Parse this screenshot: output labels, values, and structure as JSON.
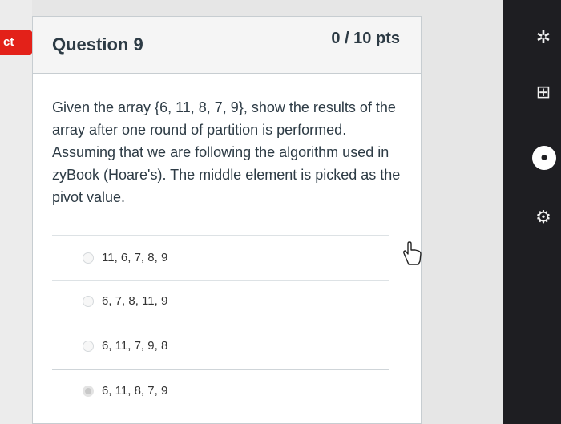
{
  "left_tab": {
    "label": "ct"
  },
  "question": {
    "title": "Question 9",
    "points": "0 / 10 pts",
    "text": "Given the array {6, 11, 8, 7, 9}, show the results of the array after one round of partition is performed. Assuming that we are following the algorithm used in zyBook (Hoare's). The middle element is picked as the pivot value.",
    "answers": [
      {
        "label": "11, 6, 7, 8, 9",
        "selected": false
      },
      {
        "label": "6, 7, 8, 11, 9",
        "selected": false
      },
      {
        "label": "6, 11, 7, 9, 8",
        "selected": false
      },
      {
        "label": "6, 11, 8, 7, 9",
        "selected": true
      }
    ]
  },
  "sidebar_icons": [
    "bug-icon",
    "layout-icon",
    "github-icon",
    "settings-icon"
  ],
  "colors": {
    "incorrect": "#e32119",
    "card_border": "#c7cdd1",
    "text": "#2d3b45",
    "dark_sidebar": "#1e1e22"
  }
}
